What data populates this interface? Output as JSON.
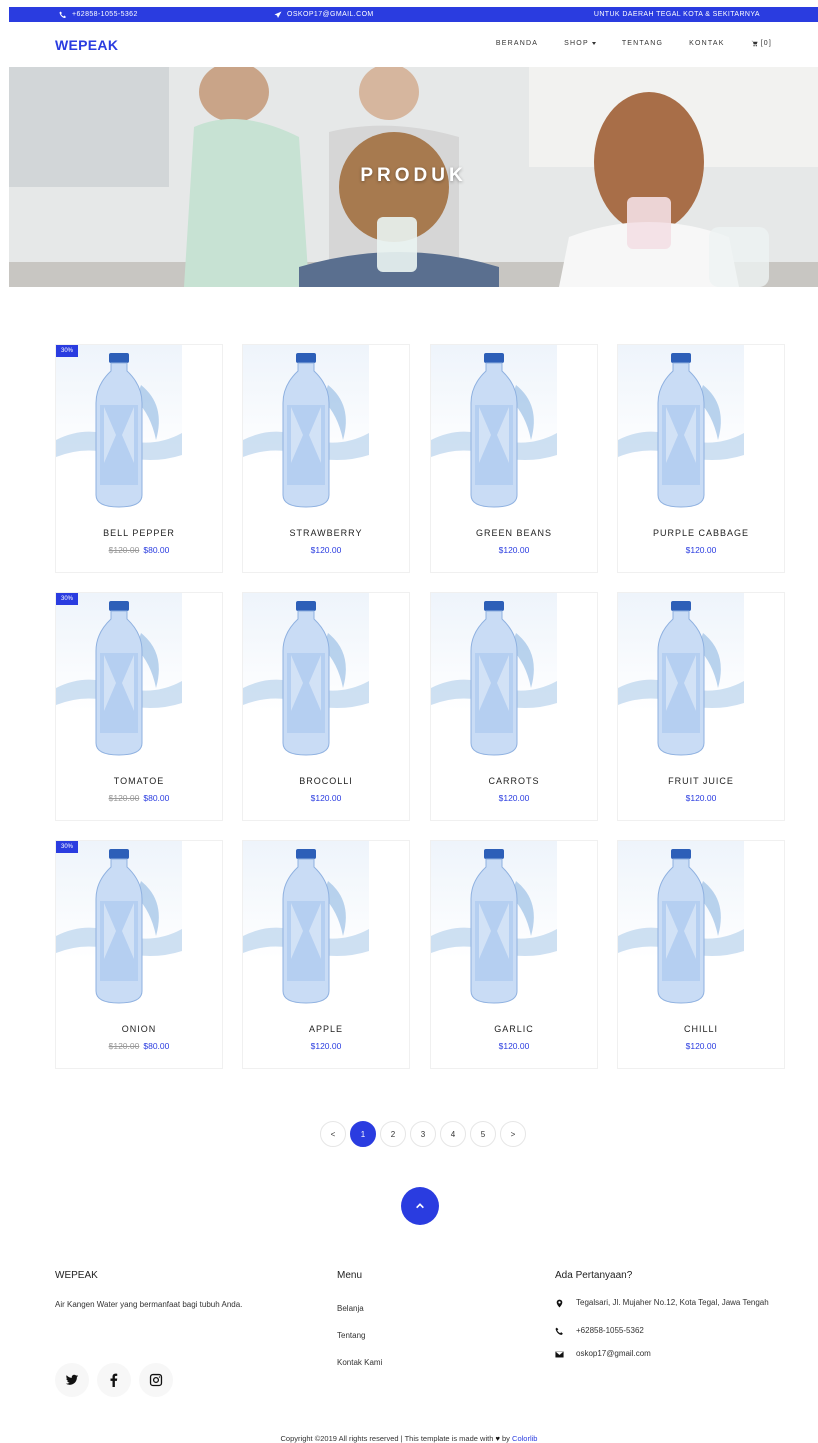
{
  "topbar": {
    "phone": "+62858-1055-5362",
    "email": "OSKOP17@GMAIL.COM",
    "region": "UNTUK DAERAH TEGAL KOTA & SEKITARNYA"
  },
  "nav": {
    "brand": "WEPEAK",
    "items": [
      "BERANDA",
      "SHOP",
      "TENTANG",
      "KONTAK"
    ],
    "cart": "[0]"
  },
  "hero": {
    "title": "PRODUK"
  },
  "products": [
    {
      "name": "BELL PEPPER",
      "price": "$80.00",
      "old_price": "$120.00",
      "badge": "30%"
    },
    {
      "name": "STRAWBERRY",
      "price": "$120.00"
    },
    {
      "name": "GREEN BEANS",
      "price": "$120.00"
    },
    {
      "name": "PURPLE CABBAGE",
      "price": "$120.00"
    },
    {
      "name": "TOMATOE",
      "price": "$80.00",
      "old_price": "$120.00",
      "badge": "30%"
    },
    {
      "name": "BROCOLLI",
      "price": "$120.00"
    },
    {
      "name": "CARROTS",
      "price": "$120.00"
    },
    {
      "name": "FRUIT JUICE",
      "price": "$120.00"
    },
    {
      "name": "ONION",
      "price": "$80.00",
      "old_price": "$120.00",
      "badge": "30%"
    },
    {
      "name": "APPLE",
      "price": "$120.00"
    },
    {
      "name": "GARLIC",
      "price": "$120.00"
    },
    {
      "name": "CHILLI",
      "price": "$120.00"
    }
  ],
  "pagination": {
    "prev": "<",
    "pages": [
      "1",
      "2",
      "3",
      "4",
      "5"
    ],
    "next": ">",
    "active": "1"
  },
  "footer": {
    "brand_title": "WEPEAK",
    "description": "Air Kangen Water yang bermanfaat bagi tubuh Anda.",
    "menu_title": "Menu",
    "menu_links": [
      "Belanja",
      "Tentang",
      "Kontak Kami"
    ],
    "contact_title": "Ada Pertanyaan?",
    "address": "Tegalsari, Jl. Mujaher No.12, Kota Tegal, Jawa Tengah",
    "phone": "+62858-1055-5362",
    "email": "oskop17@gmail.com",
    "copyright_prefix": "Copyright ©2019 All rights reserved | This template is made with",
    "copyright_by": "by",
    "copyright_link": "Colorlib"
  },
  "colors": {
    "accent": "#2a3ce0"
  },
  "icons": [
    "phone-icon",
    "paper-plane-icon",
    "cart-icon",
    "chevron-up-icon",
    "twitter-icon",
    "facebook-icon",
    "instagram-icon",
    "map-marker-icon",
    "envelope-icon",
    "heart-icon"
  ]
}
